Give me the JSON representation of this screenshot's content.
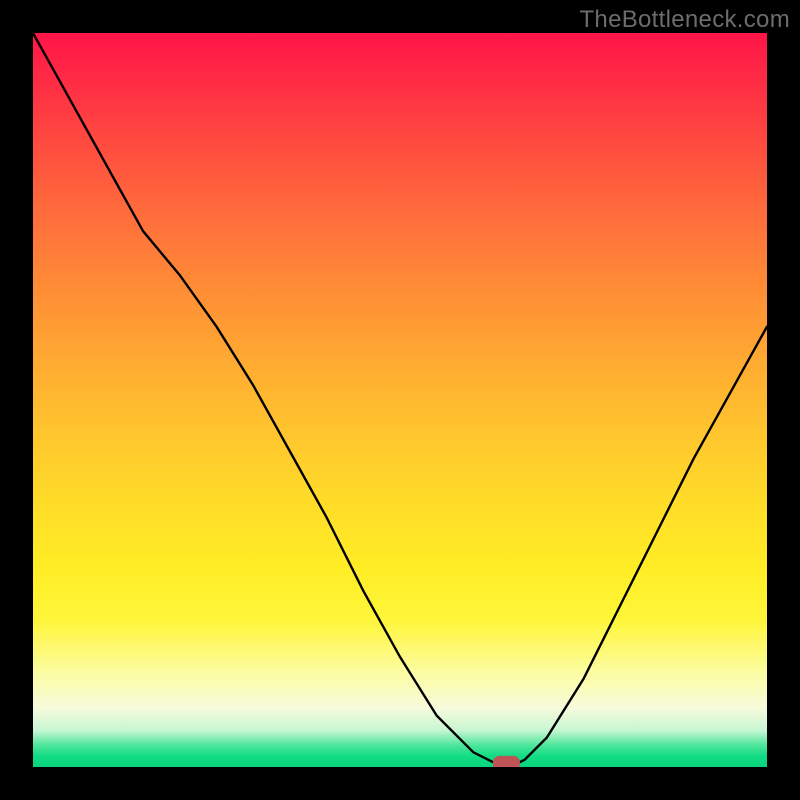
{
  "watermark": "TheBottleneck.com",
  "colors": {
    "frame_bg": "#000000",
    "curve": "#000000",
    "marker": "#c05454",
    "gradient_top": "#ff1448",
    "gradient_bottom": "#06d47c"
  },
  "chart_data": {
    "type": "line",
    "title": "",
    "xlabel": "",
    "ylabel": "",
    "xlim": [
      0,
      100
    ],
    "ylim": [
      0,
      100
    ],
    "grid": false,
    "series": [
      {
        "name": "bottleneck-curve",
        "x": [
          0,
          5,
          10,
          15,
          20,
          25,
          30,
          35,
          40,
          45,
          50,
          55,
          60,
          62,
          64,
          65,
          67,
          70,
          75,
          80,
          85,
          90,
          95,
          100
        ],
        "y": [
          100,
          91,
          82,
          73,
          67,
          60,
          52,
          43,
          34,
          24,
          15,
          7,
          2,
          1,
          0,
          0,
          1,
          4,
          12,
          22,
          32,
          42,
          51,
          60
        ]
      }
    ],
    "annotations": [
      {
        "name": "optimal-marker",
        "x": 64.5,
        "y": 0.5
      }
    ]
  }
}
